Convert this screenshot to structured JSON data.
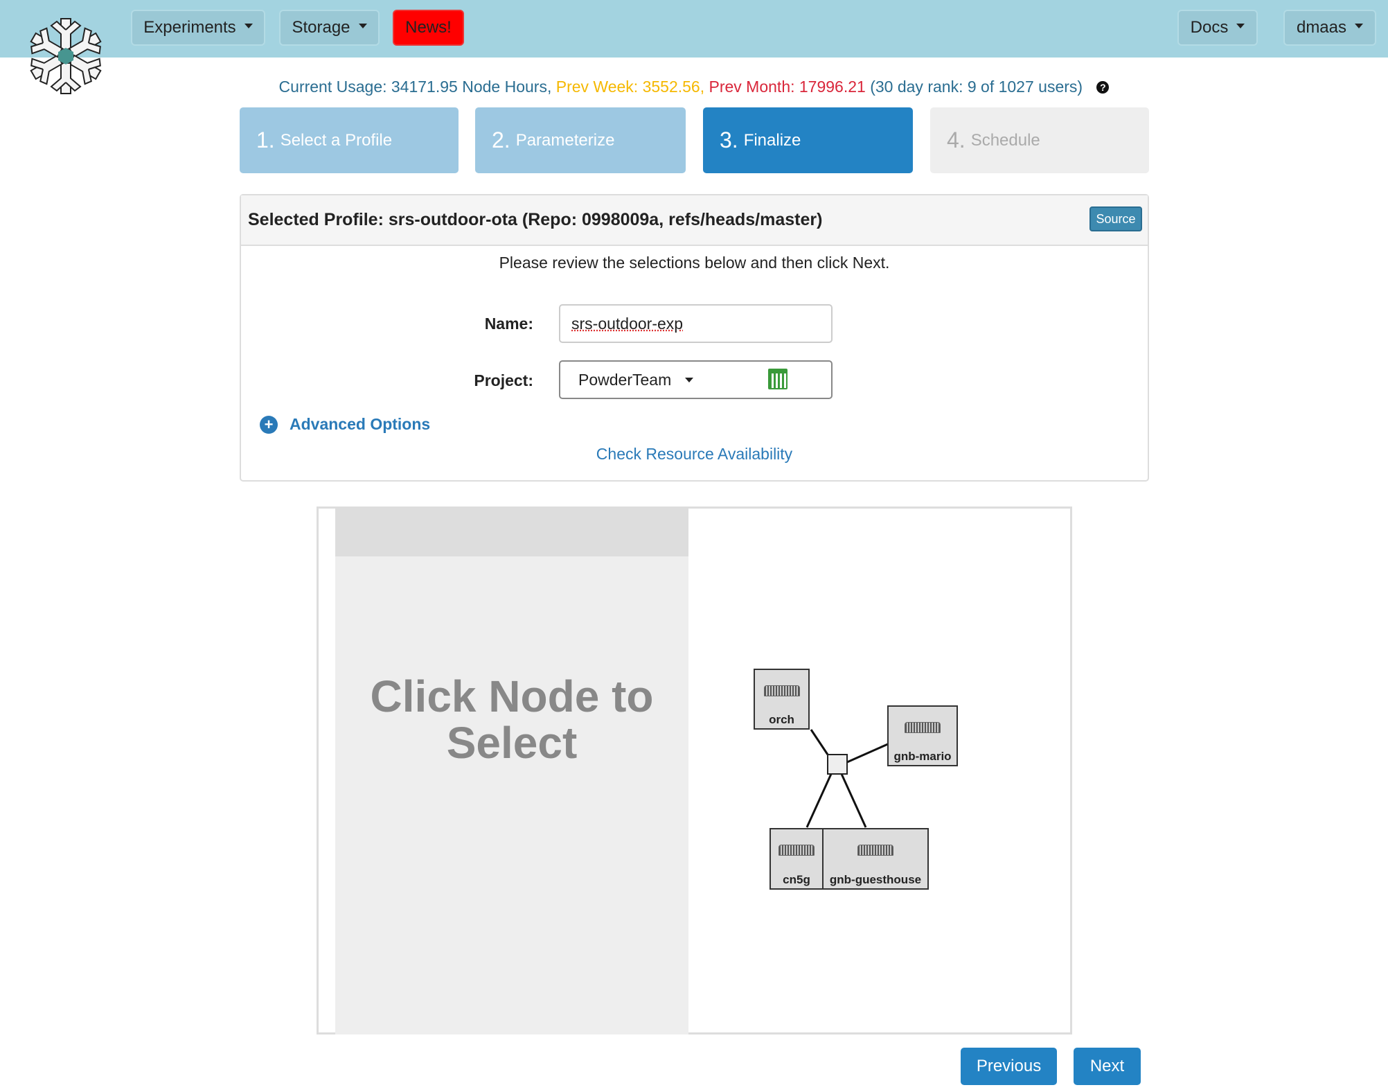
{
  "navbar": {
    "experiments": "Experiments",
    "storage": "Storage",
    "news": "News!",
    "docs": "Docs",
    "user": "dmaas"
  },
  "usage": {
    "current": "Current Usage: 34171.95 Node Hours,",
    "prev_week": " Prev Week: 3552.56,",
    "prev_month": " Prev Month: 17996.21",
    "rank": " (30 day rank: 9 of 1027 users)",
    "help_icon": "?"
  },
  "steps": [
    {
      "num": "1.",
      "label": "Select a Profile",
      "state": "done"
    },
    {
      "num": "2.",
      "label": "Parameterize",
      "state": "done"
    },
    {
      "num": "3.",
      "label": "Finalize",
      "state": "active"
    },
    {
      "num": "4.",
      "label": "Schedule",
      "state": "disabled"
    }
  ],
  "panel": {
    "title": "Selected Profile: srs-outdoor-ota (Repo: 0998009a, refs/heads/master)",
    "source_button": "Source",
    "instructions": "Please review the selections below and then click Next.",
    "name_label": "Name:",
    "name_value": "srs-outdoor-exp",
    "project_label": "Project:",
    "project_value": "PowderTeam",
    "advanced_options": "Advanced Options",
    "check_availability": "Check Resource Availability"
  },
  "topology": {
    "placeholder": "Click Node to Select",
    "nodes": [
      "orch",
      "gnb-mario",
      "cn5g",
      "gnb-guesthouse"
    ]
  },
  "footer": {
    "previous": "Previous",
    "next": "Next"
  },
  "colors": {
    "navbar": "#a3d3e0",
    "news": "#ff0000",
    "active_step": "#2383c4",
    "done_step": "#9dc8e2",
    "prev_week": "#f5b800",
    "prev_month": "#d9263a"
  }
}
